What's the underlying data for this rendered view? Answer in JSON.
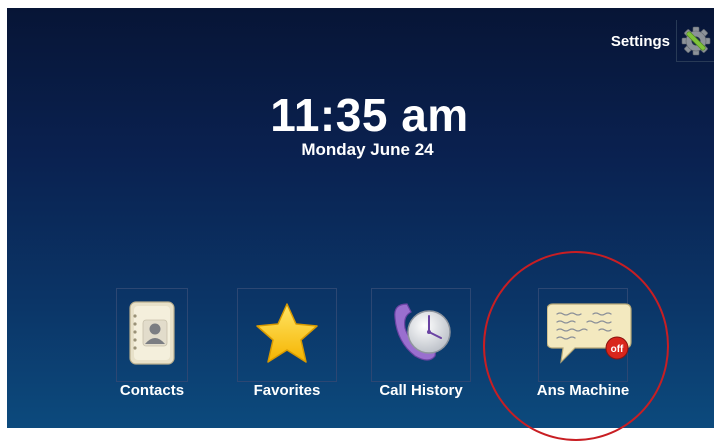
{
  "header": {
    "settings_label": "Settings",
    "settings_icon": "gear-icon"
  },
  "clock": {
    "time": "11:35 am",
    "date": "Monday June 24"
  },
  "apps": [
    {
      "label": "Contacts",
      "icon": "contacts-book-icon"
    },
    {
      "label": "Favorites",
      "icon": "star-icon"
    },
    {
      "label": "Call History",
      "icon": "phone-clock-icon"
    },
    {
      "label": "Ans Machine",
      "icon": "message-bubble-icon",
      "badge": "off"
    }
  ],
  "colors": {
    "background_top": "#071536",
    "background_bottom": "#0c4a7d",
    "highlight_ring": "#c81e23",
    "badge_red": "#d9261c"
  }
}
